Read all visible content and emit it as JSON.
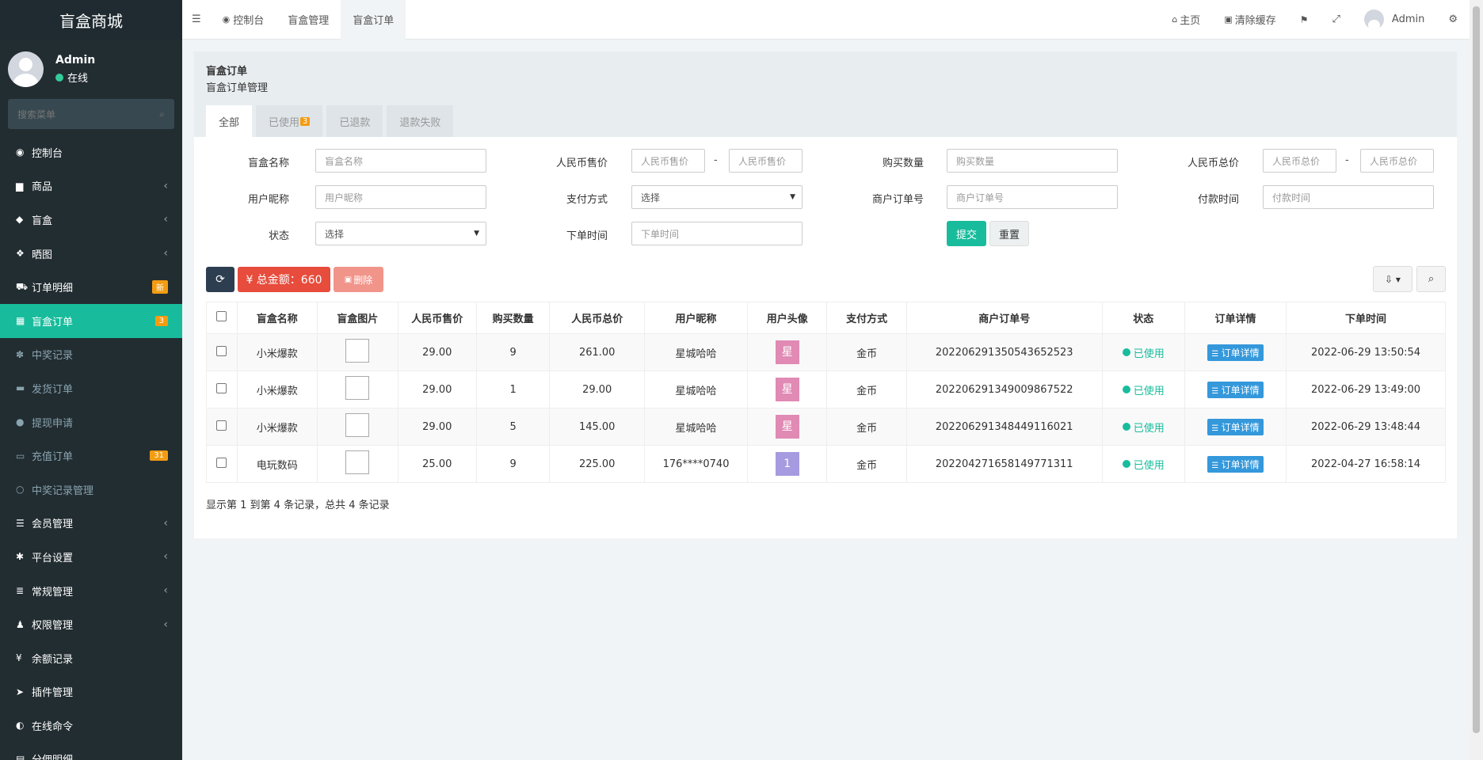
{
  "app": {
    "title": "盲盒商城"
  },
  "user": {
    "name": "Admin",
    "status": "在线"
  },
  "sidebar": {
    "search_placeholder": "搜索菜单",
    "items": [
      {
        "label": "控制台",
        "icon": "dashboard-icon",
        "glyph": "◉"
      },
      {
        "label": "商品",
        "icon": "shopping-bag-icon",
        "glyph": "▆"
      },
      {
        "label": "盲盒",
        "icon": "cube-icon",
        "glyph": "◆"
      },
      {
        "label": "晒图",
        "icon": "dropbox-icon",
        "glyph": "❖"
      },
      {
        "label": "订单明细",
        "icon": "cart-icon",
        "glyph": "⛟",
        "badge": "新"
      },
      {
        "label": "盲盒订单",
        "icon": "calendar-icon",
        "glyph": "▦",
        "badge": "3"
      },
      {
        "label": "中奖记录",
        "icon": "paw-icon",
        "glyph": "✽"
      },
      {
        "label": "发货订单",
        "icon": "truck-icon",
        "glyph": "▬"
      },
      {
        "label": "提现申请",
        "icon": "comments-icon",
        "glyph": "●"
      },
      {
        "label": "充值订单",
        "icon": "money-icon",
        "glyph": "▭",
        "badge": "31"
      },
      {
        "label": "中奖记录管理",
        "icon": "circle-icon",
        "glyph": "○"
      },
      {
        "label": "会员管理",
        "icon": "list-icon",
        "glyph": "☰"
      },
      {
        "label": "平台设置",
        "icon": "gear-icon",
        "glyph": "✱"
      },
      {
        "label": "常规管理",
        "icon": "database-icon",
        "glyph": "≣"
      },
      {
        "label": "权限管理",
        "icon": "group-icon",
        "glyph": "♟"
      },
      {
        "label": "余额记录",
        "icon": "yen-icon",
        "glyph": "¥"
      },
      {
        "label": "插件管理",
        "icon": "rocket-icon",
        "glyph": "➤"
      },
      {
        "label": "在线命令",
        "icon": "adjust-icon",
        "glyph": "◐"
      },
      {
        "label": "分佣明细",
        "icon": "list-alt-icon",
        "glyph": "▤"
      }
    ]
  },
  "topbar": {
    "menu_icon": "☰",
    "tabs": [
      {
        "label": "控制台",
        "glyph": "◉"
      },
      {
        "label": "盲盒管理",
        "glyph": ""
      },
      {
        "label": "盲盒订单",
        "glyph": ""
      }
    ],
    "home": "主页",
    "clear_cache": "清除缓存",
    "admin": "Admin"
  },
  "panel": {
    "title": "盲盒订单",
    "subtitle": "盲盒订单管理",
    "tabs": [
      {
        "label": "全部"
      },
      {
        "label": "已使用",
        "badge": "3"
      },
      {
        "label": "已退款"
      },
      {
        "label": "退款失败"
      }
    ]
  },
  "filters": {
    "name_label": "盲盒名称",
    "name_ph": "盲盒名称",
    "price_label": "人民币售价",
    "price_min_ph": "人民币售价",
    "price_max_ph": "人民币售价",
    "qty_label": "购买数量",
    "qty_ph": "购买数量",
    "total_label": "人民币总价",
    "total_min_ph": "人民币总价",
    "total_max_ph": "人民币总价",
    "nick_label": "用户昵称",
    "nick_ph": "用户昵称",
    "pay_label": "支付方式",
    "pay_value": "选择",
    "order_label": "商户订单号",
    "order_ph": "商户订单号",
    "paytime_label": "付款时间",
    "paytime_ph": "付款时间",
    "status_label": "状态",
    "status_value": "选择",
    "ordertime_label": "下单时间",
    "ordertime_ph": "下单时间",
    "dash": "-",
    "submit": "提交",
    "reset": "重置"
  },
  "toolbar": {
    "total_amount": "¥ 总金额：660",
    "delete": "删除"
  },
  "table": {
    "columns": [
      "盲盒名称",
      "盲盒图片",
      "人民币售价",
      "购买数量",
      "人民币总价",
      "用户昵称",
      "用户头像",
      "支付方式",
      "商户订单号",
      "状态",
      "订单详情",
      "下单时间"
    ],
    "rows": [
      {
        "name": "小米爆款",
        "price": "29.00",
        "qty": "9",
        "total": "261.00",
        "nick": "星城哈哈",
        "avatar": "星",
        "avatar_color": "#e08ab4",
        "pay": "金币",
        "order_no": "20220629135054365​2523",
        "status": "已使用",
        "detail": "订单详情",
        "time": "2022-06-29 13:50:54"
      },
      {
        "name": "小米爆款",
        "price": "29.00",
        "qty": "1",
        "total": "29.00",
        "nick": "星城哈哈",
        "avatar": "星",
        "avatar_color": "#e08ab4",
        "pay": "金币",
        "order_no": "20220629134900986​7522",
        "status": "已使用",
        "detail": "订单详情",
        "time": "2022-06-29 13:49:00"
      },
      {
        "name": "小米爆款",
        "price": "29.00",
        "qty": "5",
        "total": "145.00",
        "nick": "星城哈哈",
        "avatar": "星",
        "avatar_color": "#e08ab4",
        "pay": "金币",
        "order_no": "20220629134844911​6021",
        "status": "已使用",
        "detail": "订单详情",
        "time": "2022-06-29 13:48:44"
      },
      {
        "name": "电玩数码",
        "price": "25.00",
        "qty": "9",
        "total": "225.00",
        "nick": "176****0740",
        "avatar": "1",
        "avatar_color": "#a69be0",
        "pay": "金币",
        "order_no": "20220427165814977​1311",
        "status": "已使用",
        "detail": "订单详情",
        "time": "2022-04-27 16:58:14"
      }
    ]
  },
  "pagination": {
    "summary": "显示第 1 到第 4 条记录，总共 4 条记录"
  },
  "colors": {
    "accent": "#18bc9c",
    "sidebar_bg": "#222d32",
    "danger": "#e74c3c",
    "info": "#3498db",
    "badge": "#f39c12"
  }
}
